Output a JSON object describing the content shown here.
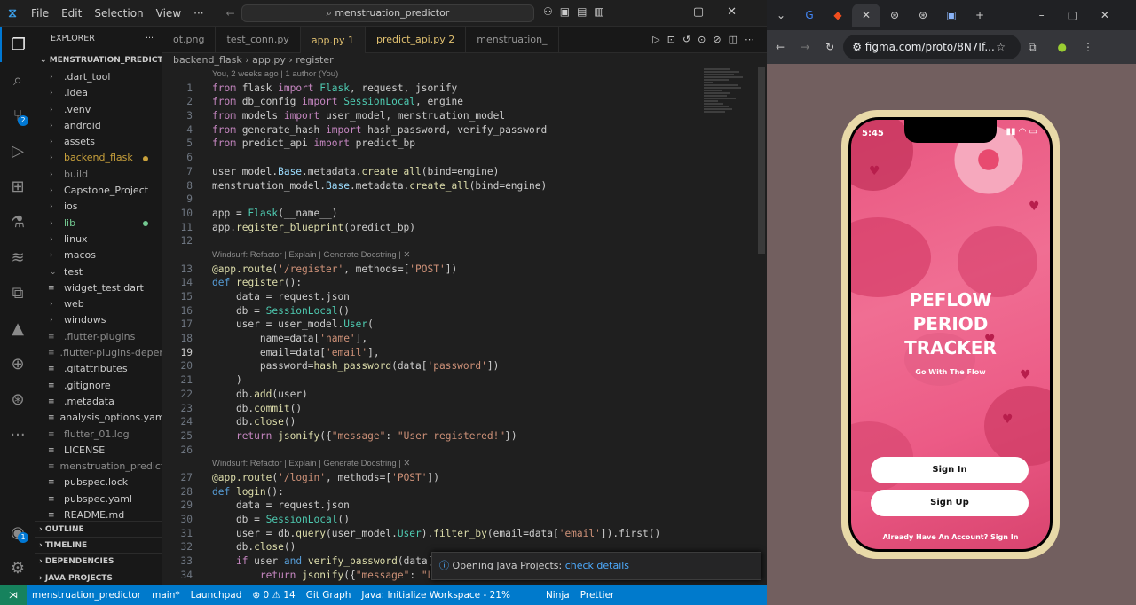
{
  "vscode": {
    "menu": [
      "File",
      "Edit",
      "Selection",
      "View",
      "···"
    ],
    "command_center": "menstruation_predictor",
    "explorer_title": "EXPLORER",
    "project": "MENSTRUATION_PREDICT...",
    "tree": [
      {
        "label": ".dart_tool",
        "kind": "folder"
      },
      {
        "label": ".idea",
        "kind": "folder"
      },
      {
        "label": ".venv",
        "kind": "folder"
      },
      {
        "label": "android",
        "kind": "folder"
      },
      {
        "label": "assets",
        "kind": "folder"
      },
      {
        "label": "backend_flask",
        "kind": "folder",
        "state": "mod"
      },
      {
        "label": "build",
        "kind": "folder",
        "state": "dim"
      },
      {
        "label": "Capstone_Project",
        "kind": "folder"
      },
      {
        "label": "ios",
        "kind": "folder"
      },
      {
        "label": "lib",
        "kind": "folder",
        "state": "green"
      },
      {
        "label": "linux",
        "kind": "folder"
      },
      {
        "label": "macos",
        "kind": "folder"
      },
      {
        "label": "test",
        "kind": "folder-open"
      },
      {
        "label": "widget_test.dart",
        "kind": "file"
      },
      {
        "label": "web",
        "kind": "folder"
      },
      {
        "label": "windows",
        "kind": "folder"
      },
      {
        "label": ".flutter-plugins",
        "kind": "file",
        "state": "dim"
      },
      {
        "label": ".flutter-plugins-depen...",
        "kind": "file",
        "state": "dim"
      },
      {
        "label": ".gitattributes",
        "kind": "file"
      },
      {
        "label": ".gitignore",
        "kind": "file"
      },
      {
        "label": ".metadata",
        "kind": "file"
      },
      {
        "label": "analysis_options.yaml",
        "kind": "file"
      },
      {
        "label": "flutter_01.log",
        "kind": "file",
        "state": "dim"
      },
      {
        "label": "LICENSE",
        "kind": "file"
      },
      {
        "label": "menstruation_predict...",
        "kind": "file",
        "state": "dim"
      },
      {
        "label": "pubspec.lock",
        "kind": "file"
      },
      {
        "label": "pubspec.yaml",
        "kind": "file"
      },
      {
        "label": "README.md",
        "kind": "file"
      }
    ],
    "sections": [
      "OUTLINE",
      "TIMELINE",
      "DEPENDENCIES",
      "JAVA PROJECTS"
    ],
    "tabs": [
      {
        "label": "ot.png"
      },
      {
        "label": "test_conn.py"
      },
      {
        "label": "app.py  1",
        "active": true
      },
      {
        "label": "predict_api.py 2",
        "err": true
      },
      {
        "label": "menstruation_"
      }
    ],
    "breadcrumbs": "backend_flask  ›  app.py  ›  register",
    "blame": "You, 2 weeks ago | 1 author (You)",
    "lens": "Windsurf: Refactor | Explain | Generate Docstring | ✕",
    "toast": {
      "text": "Opening Java Projects: ",
      "link": "check details"
    },
    "status": [
      "menstruation_predictor",
      "main*",
      "Launchpad",
      "⊗ 0 ⚠ 14",
      "Git Graph",
      "Java: Initialize Workspace - 21%",
      "Ninja",
      "Prettier"
    ],
    "activity_badges": {
      "scm": "2",
      "account": "1"
    }
  },
  "chrome": {
    "url": "figma.com/proto/8N7If...",
    "phone": {
      "time": "5:45",
      "title_lines": [
        "PEFLOW",
        "PERIOD",
        "TRACKER"
      ],
      "subtitle": "Go With The Flow",
      "signin": "Sign In",
      "signup": "Sign Up",
      "footer": "Already Have An Account?   Sign In",
      "bg_color": "#ec5b86"
    }
  }
}
